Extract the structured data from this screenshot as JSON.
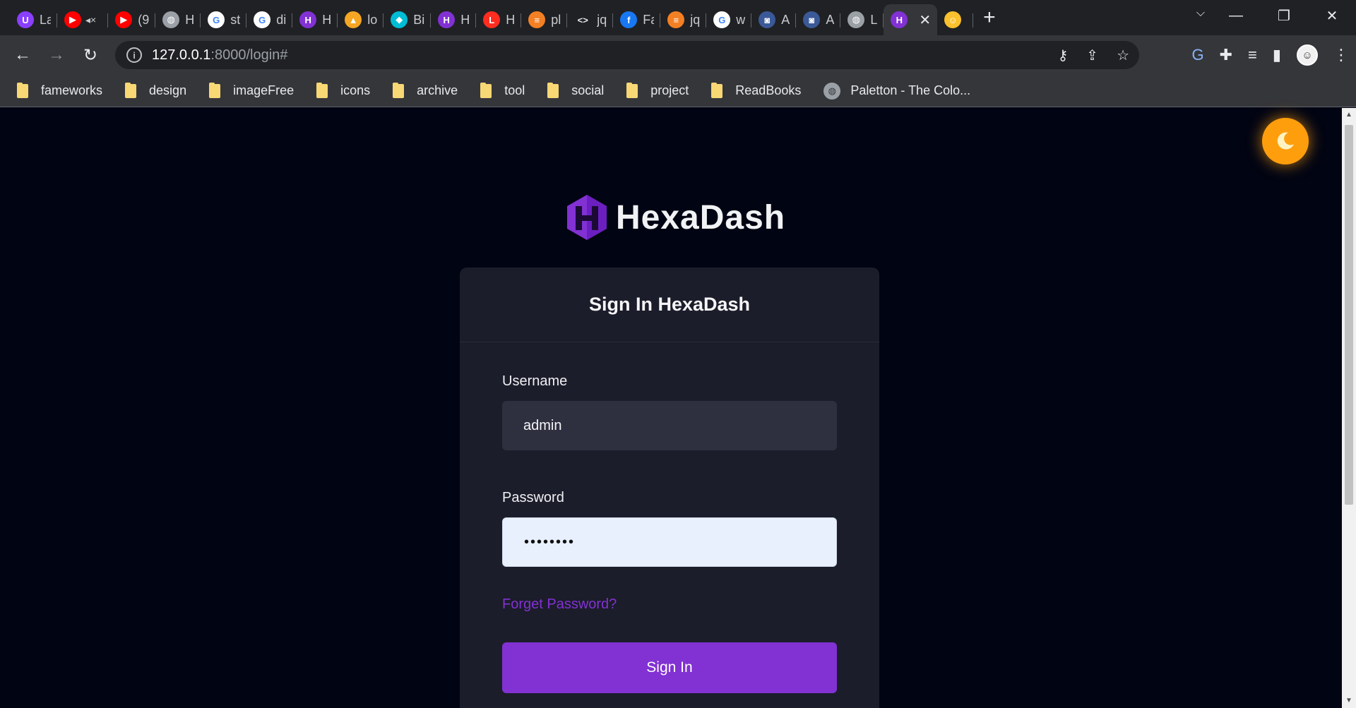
{
  "browser": {
    "tabs": [
      {
        "label": "La",
        "icon": "u-icon",
        "color": "#8a3ffc",
        "glyph": "U"
      },
      {
        "label": "",
        "icon": "youtube-icon",
        "color": "#ff0000",
        "glyph": "▶",
        "muted": true
      },
      {
        "label": "(9",
        "icon": "youtube-icon",
        "color": "#ff0000",
        "glyph": "▶"
      },
      {
        "label": "H",
        "icon": "globe-icon",
        "color": "#9aa0a6",
        "glyph": "◍"
      },
      {
        "label": "st",
        "icon": "google-icon",
        "color": "#ffffff",
        "glyph": "G"
      },
      {
        "label": "di",
        "icon": "google-icon",
        "color": "#ffffff",
        "glyph": "G"
      },
      {
        "label": "H",
        "icon": "hexadash-icon",
        "color": "#8231d3",
        "glyph": "H"
      },
      {
        "label": "lo",
        "icon": "mountain-icon",
        "color": "#f5a623",
        "glyph": "▲"
      },
      {
        "label": "Bi",
        "icon": "cube-icon",
        "color": "#00bcd4",
        "glyph": "◆"
      },
      {
        "label": "H",
        "icon": "hexadash-icon",
        "color": "#8231d3",
        "glyph": "H"
      },
      {
        "label": "H",
        "icon": "laravel-icon",
        "color": "#ff2d20",
        "glyph": "L"
      },
      {
        "label": "pl",
        "icon": "stackoverflow-icon",
        "color": "#f48024",
        "glyph": "≡"
      },
      {
        "label": "jq",
        "icon": "code-icon",
        "color": "#e8eaed",
        "glyph": "<>"
      },
      {
        "label": "Fa",
        "icon": "facebook-icon",
        "color": "#1877f2",
        "glyph": "f"
      },
      {
        "label": "jq",
        "icon": "stackoverflow-icon",
        "color": "#f48024",
        "glyph": "≡"
      },
      {
        "label": "w",
        "icon": "google-icon",
        "color": "#ffffff",
        "glyph": "G"
      },
      {
        "label": "A",
        "icon": "mask-icon",
        "color": "#3b5998",
        "glyph": "◙"
      },
      {
        "label": "A",
        "icon": "mask-icon",
        "color": "#3b5998",
        "glyph": "◙"
      },
      {
        "label": "L",
        "icon": "globe-icon",
        "color": "#9aa0a6",
        "glyph": "◍"
      },
      {
        "label": "",
        "icon": "hexadash-icon",
        "color": "#8231d3",
        "glyph": "H",
        "active": true
      },
      {
        "label": "",
        "icon": "emoji-icon",
        "color": "#fbc02d",
        "glyph": "☺"
      }
    ],
    "address": {
      "host": "127.0.0.1",
      "rest": ":8000/login#"
    },
    "bookmarks": [
      {
        "label": "fameworks"
      },
      {
        "label": "design"
      },
      {
        "label": "imageFree"
      },
      {
        "label": "icons"
      },
      {
        "label": "archive"
      },
      {
        "label": "tool"
      },
      {
        "label": "social"
      },
      {
        "label": "project"
      },
      {
        "label": "ReadBooks"
      },
      {
        "label": "Paletton - The Colo...",
        "site": true
      }
    ]
  },
  "page": {
    "brand": "HexaDash",
    "title": "Sign In HexaDash",
    "username_label": "Username",
    "username_value": "admin",
    "password_label": "Password",
    "password_value": "password",
    "forget_link": "Forget Password?",
    "signin_button": "Sign In",
    "colors": {
      "primary": "#8231d3",
      "background": "#010413",
      "card": "#1b1d2a",
      "toggle": "#ff9e0d"
    }
  }
}
